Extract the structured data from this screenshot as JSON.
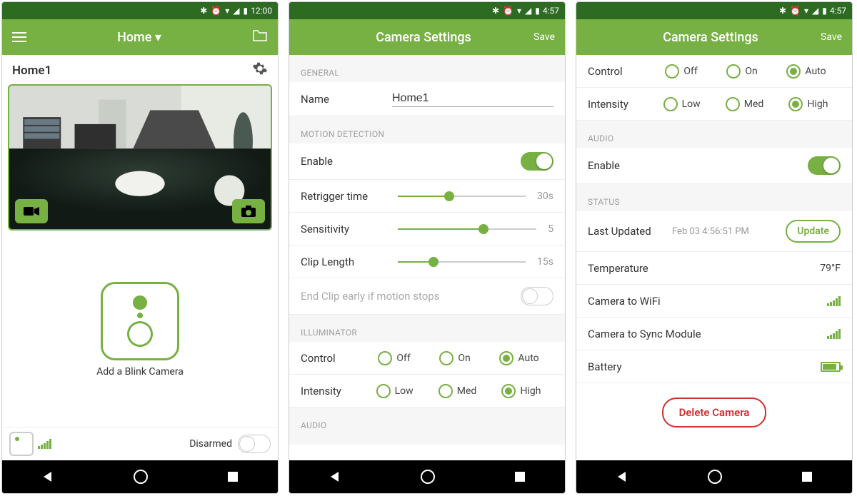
{
  "status": {
    "time1": "12:00",
    "time2": "4:57"
  },
  "screen1": {
    "title": "Home ▾",
    "device_name": "Home1",
    "add_label": "Add a Blink Camera",
    "armed_label": "Disarmed"
  },
  "screen2": {
    "title": "Camera Settings",
    "save": "Save",
    "sections": {
      "general": "GENERAL",
      "motion": "MOTION DETECTION",
      "illuminator": "ILLUMINATOR",
      "audio": "AUDIO"
    },
    "name_label": "Name",
    "name_value": "Home1",
    "enable_label": "Enable",
    "retrigger_label": "Retrigger time",
    "retrigger_value": "30s",
    "sensitivity_label": "Sensitivity",
    "sensitivity_value": "5",
    "clip_label": "Clip Length",
    "clip_value": "15s",
    "endclip_label": "End Clip early if motion stops",
    "control_label": "Control",
    "control_opts": {
      "off": "Off",
      "on": "On",
      "auto": "Auto"
    },
    "intensity_label": "Intensity",
    "intensity_opts": {
      "low": "Low",
      "med": "Med",
      "high": "High"
    }
  },
  "screen3": {
    "title": "Camera Settings",
    "save": "Save",
    "control_label": "Control",
    "control_opts": {
      "off": "Off",
      "on": "On",
      "auto": "Auto"
    },
    "intensity_label": "Intensity",
    "intensity_opts": {
      "low": "Low",
      "med": "Med",
      "high": "High"
    },
    "audio_header": "AUDIO",
    "enable_label": "Enable",
    "status_header": "STATUS",
    "last_updated_label": "Last Updated",
    "last_updated_value": "Feb 03 4:56:51 PM",
    "update_btn": "Update",
    "temperature_label": "Temperature",
    "temperature_value": "79°F",
    "wifi_label": "Camera to WiFi",
    "sync_label": "Camera to Sync Module",
    "battery_label": "Battery",
    "delete_btn": "Delete Camera"
  }
}
